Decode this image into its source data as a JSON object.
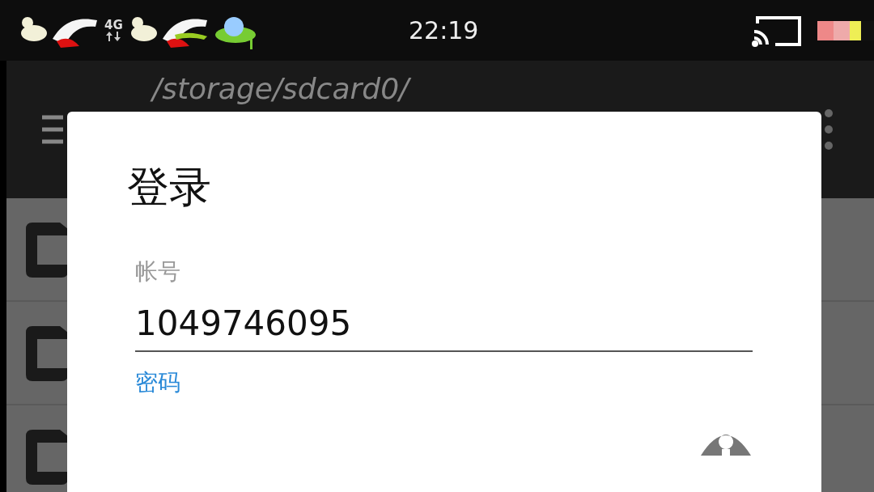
{
  "status_bar": {
    "network": "4G",
    "time": "22:19"
  },
  "app_bar": {
    "title": "/storage/sdcard0/"
  },
  "file_list": {
    "rows": [
      {
        "kind": "folder"
      },
      {
        "kind": "folder"
      },
      {
        "kind": "folder"
      }
    ]
  },
  "dialog": {
    "title": "登录",
    "fields": [
      {
        "label": "帐号",
        "value": "1049746095",
        "focused": false
      },
      {
        "label": "密码",
        "focused": true
      }
    ]
  }
}
